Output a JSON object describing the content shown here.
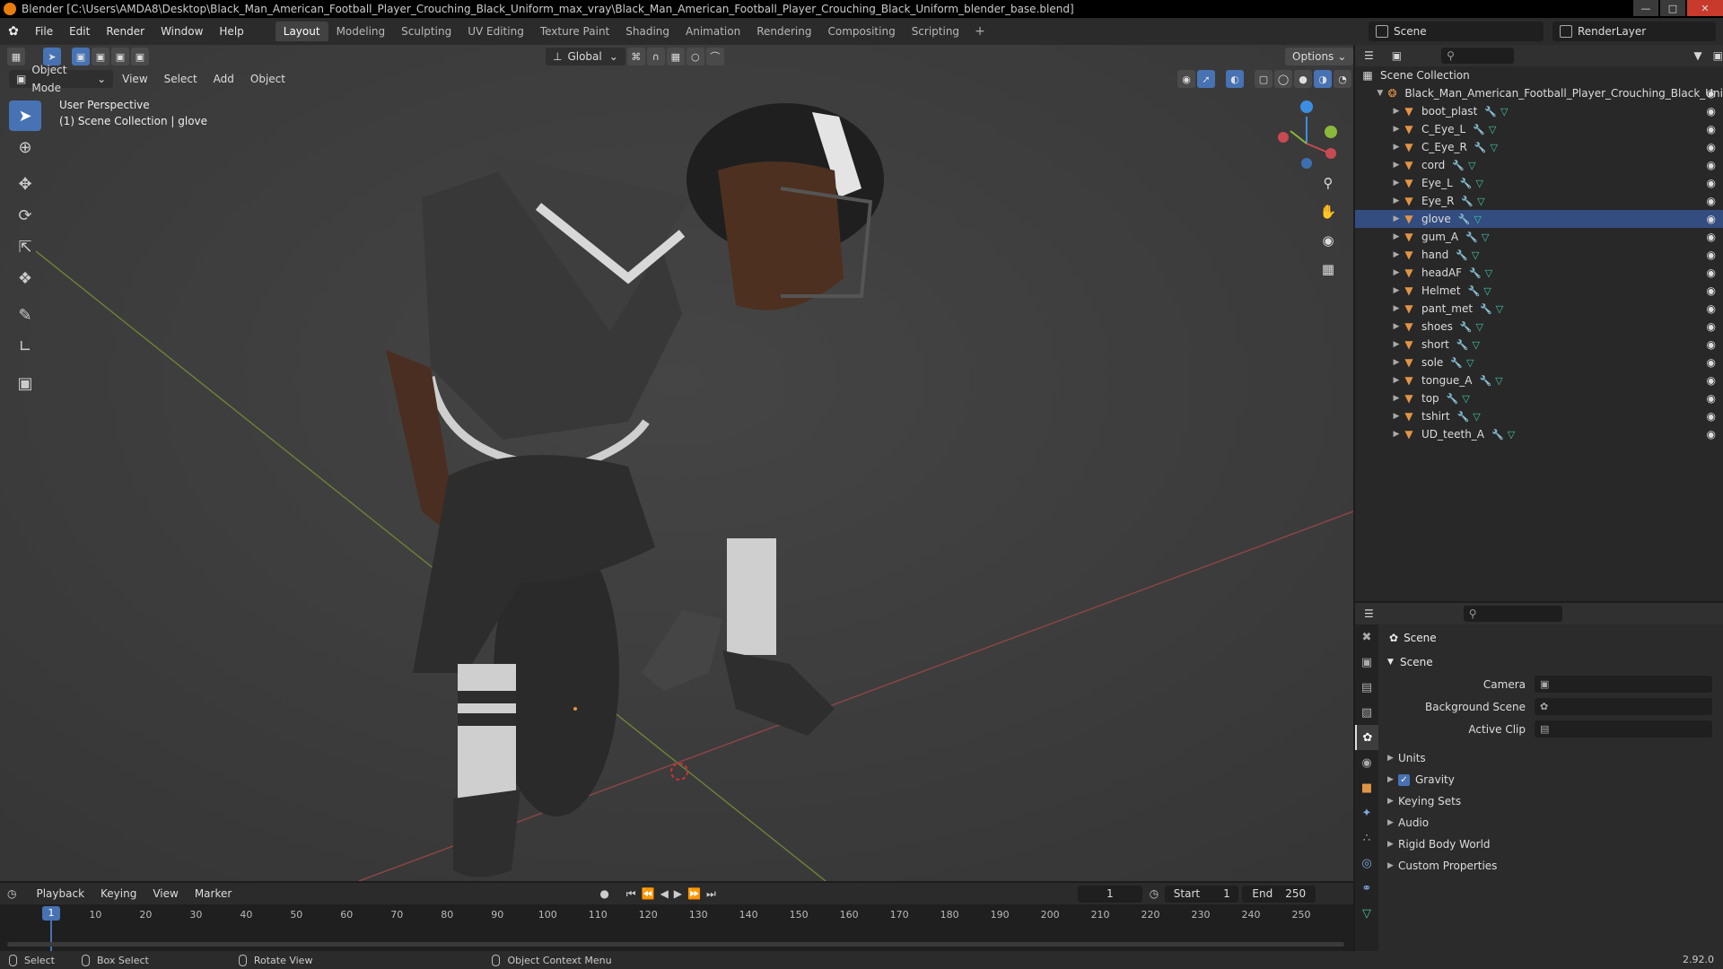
{
  "window": {
    "title": "Blender [C:\\Users\\AMDA8\\Desktop\\Black_Man_American_Football_Player_Crouching_Black_Uniform_max_vray\\Black_Man_American_Football_Player_Crouching_Black_Uniform_blender_base.blend]"
  },
  "menu": [
    "File",
    "Edit",
    "Render",
    "Window",
    "Help"
  ],
  "workspaces": [
    "Layout",
    "Modeling",
    "Sculpting",
    "UV Editing",
    "Texture Paint",
    "Shading",
    "Animation",
    "Rendering",
    "Compositing",
    "Scripting"
  ],
  "active_workspace": "Layout",
  "scene_selector": "Scene",
  "view_layer_selector": "RenderLayer",
  "viewport": {
    "mode": "Object Mode",
    "menus": [
      "View",
      "Select",
      "Add",
      "Object"
    ],
    "transform_orientation": "Global",
    "options_label": "Options",
    "info_line1": "User Perspective",
    "info_line2": "(1) Scene Collection | glove"
  },
  "outliner": {
    "root": "Scene Collection",
    "collection": "Black_Man_American_Football_Player_Crouching_Black_Uni",
    "items": [
      "boot_plast",
      "C_Eye_L",
      "C_Eye_R",
      "cord",
      "Eye_L",
      "Eye_R",
      "glove",
      "gum_A",
      "hand",
      "headAF",
      "Helmet",
      "pant_met",
      "shoes",
      "short",
      "sole",
      "tongue_A",
      "top",
      "tshirt",
      "UD_teeth_A"
    ],
    "selected": "glove"
  },
  "properties": {
    "context": "Scene",
    "panel": "Scene",
    "fields": [
      {
        "label": "Camera",
        "value": ""
      },
      {
        "label": "Background Scene",
        "value": ""
      },
      {
        "label": "Active Clip",
        "value": ""
      }
    ],
    "subpanels": [
      "Units",
      "Gravity",
      "Keying Sets",
      "Audio",
      "Rigid Body World",
      "Custom Properties"
    ],
    "gravity_checked": true
  },
  "timeline": {
    "menus": [
      "Playback",
      "Keying",
      "View",
      "Marker"
    ],
    "current_frame": "1",
    "start_label": "Start",
    "start": "1",
    "end_label": "End",
    "end": "250",
    "ticks": [
      "1",
      "10",
      "20",
      "30",
      "40",
      "50",
      "60",
      "70",
      "80",
      "90",
      "100",
      "110",
      "120",
      "130",
      "140",
      "150",
      "160",
      "170",
      "180",
      "190",
      "200",
      "210",
      "220",
      "230",
      "240",
      "250"
    ]
  },
  "statusbar": {
    "select": "Select",
    "box_select": "Box Select",
    "rotate_view": "Rotate View",
    "context_menu": "Object Context Menu",
    "version": "2.92.0"
  },
  "colors": {
    "accent": "#4772b3",
    "object_icon": "#e29446",
    "x_axis": "#c84a52",
    "y_axis": "#8bb93b",
    "z_axis": "#3c8fe0"
  }
}
